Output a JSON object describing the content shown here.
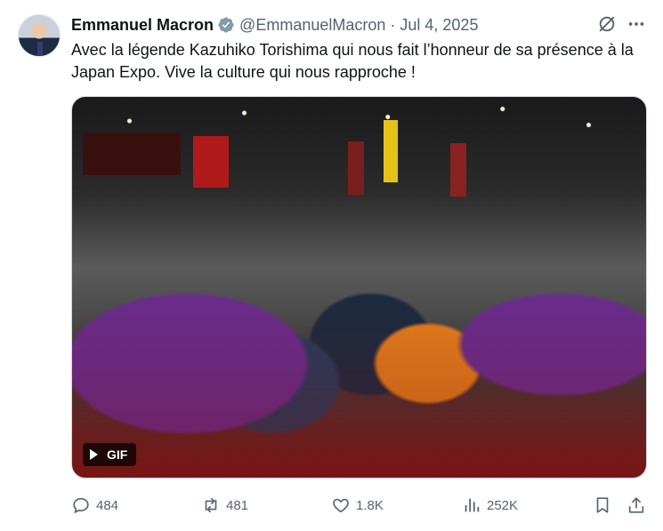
{
  "author": {
    "name": "Emmanuel Macron",
    "handle": "@EmmanuelMacron",
    "separator": "·",
    "date": "Jul 4, 2025",
    "verified": true
  },
  "tweet": {
    "text": "Avec la légende Kazuhiko Torishima qui nous fait l’honneur de sa présence à la Japan Expo. Vive la culture qui nous rapproche !"
  },
  "media": {
    "type": "gif",
    "badge_label": "GIF"
  },
  "actions": {
    "replies": "484",
    "reposts": "481",
    "likes": "1.8K",
    "views": "252K"
  },
  "icons": {
    "verified": "verified-badge-icon",
    "grok": "grok-icon",
    "more": "more-icon",
    "reply": "reply-icon",
    "repost": "repost-icon",
    "like": "heart-icon",
    "views": "views-icon",
    "bookmark": "bookmark-icon",
    "share": "share-icon"
  },
  "colors": {
    "text": "#0f1419",
    "secondary": "#536471",
    "verified": "#829aab"
  }
}
